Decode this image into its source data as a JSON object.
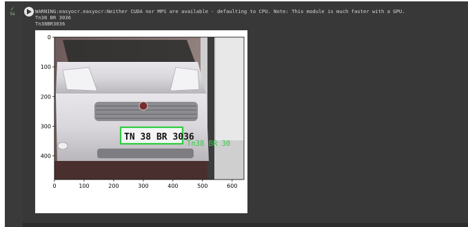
{
  "cell": {
    "exec_count": "5s",
    "log_lines": [
      "WARNING:easyocr.easyocr:Neither CUDA nor MPS are available - defaulting to CPU. Note: This module is much faster with a GPU.",
      "Tn38 BR 3036",
      "Tn38BR3036"
    ]
  },
  "figure": {
    "detected_text": "Tn38 BR 3036",
    "plate_text": "TN 38 BR 3036",
    "overlay_text": "Tn38 BR 30",
    "box_color": "#2ecc40",
    "x_ticks": [
      "0",
      "100",
      "200",
      "300",
      "400",
      "500",
      "600"
    ],
    "y_ticks": [
      "0",
      "100",
      "200",
      "300",
      "400"
    ]
  },
  "chart_data": {
    "type": "image",
    "x_ticks": [
      0,
      100,
      200,
      300,
      400,
      500,
      600
    ],
    "y_ticks": [
      0,
      100,
      200,
      300,
      400
    ],
    "xlim": [
      0,
      640
    ],
    "ylim": [
      480,
      0
    ]
  }
}
